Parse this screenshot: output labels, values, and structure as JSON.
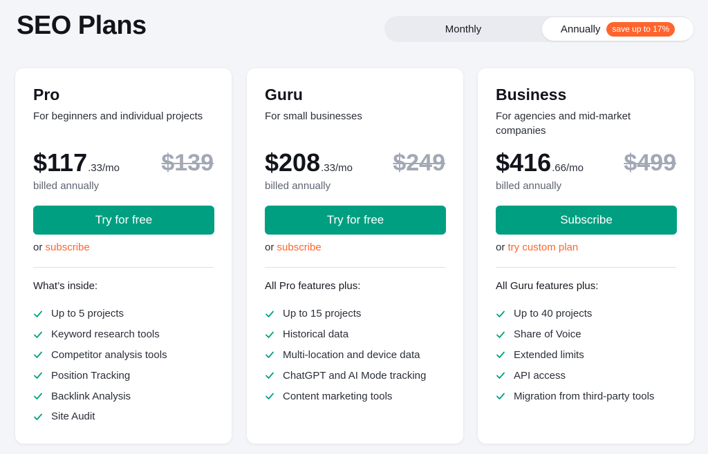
{
  "page_title": "SEO Plans",
  "billing_toggle": {
    "monthly_label": "Monthly",
    "annually_label": "Annually",
    "save_badge": "save up to 17%",
    "selected": "annually"
  },
  "colors": {
    "accent_green": "#009f81",
    "accent_orange": "#ff642d",
    "check_color": "#009f81"
  },
  "plans": [
    {
      "name": "Pro",
      "description": "For beginners and individual projects",
      "price_int": "$117",
      "price_dec": ".33/mo",
      "price_old": "$139",
      "billed": "billed annually",
      "cta_label": "Try for free",
      "alt_prefix": "or",
      "alt_link": "subscribe",
      "features_heading": "What’s inside:",
      "features": [
        "Up to 5 projects",
        "Keyword research tools",
        "Competitor analysis tools",
        "Position Tracking",
        "Backlink Analysis",
        "Site Audit"
      ]
    },
    {
      "name": "Guru",
      "description": "For small businesses",
      "price_int": "$208",
      "price_dec": ".33/mo",
      "price_old": "$249",
      "billed": "billed annually",
      "cta_label": "Try for free",
      "alt_prefix": "or",
      "alt_link": "subscribe",
      "features_heading": "All Pro features plus:",
      "features": [
        "Up to 15 projects",
        "Historical data",
        "Multi-location and device data",
        "ChatGPT and AI Mode tracking",
        "Content marketing tools"
      ]
    },
    {
      "name": "Business",
      "description": "For agencies and mid-market companies",
      "price_int": "$416",
      "price_dec": ".66/mo",
      "price_old": "$499",
      "billed": "billed annually",
      "cta_label": "Subscribe",
      "alt_prefix": "or",
      "alt_link": "try custom plan",
      "features_heading": "All Guru features plus:",
      "features": [
        "Up to 40 projects",
        "Share of Voice",
        "Extended limits",
        "API access",
        "Migration from third-party tools"
      ]
    }
  ]
}
